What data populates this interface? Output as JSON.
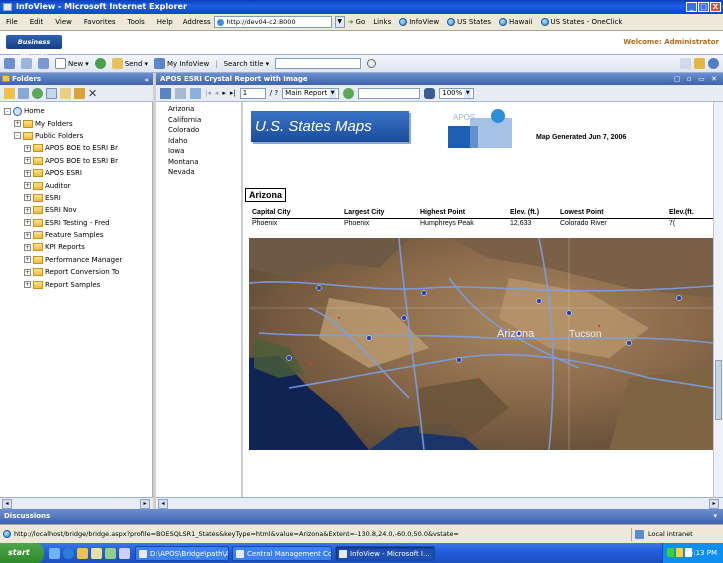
{
  "window": {
    "title": "InfoView - Microsoft Internet Explorer",
    "buttons": [
      "_",
      "□",
      "X"
    ]
  },
  "menubar": {
    "items": [
      "File",
      "Edit",
      "View",
      "Favorites",
      "Tools",
      "Help"
    ],
    "address_label": "Address",
    "address_value": "http://dev04-c2:8000",
    "go_label": "Go",
    "links_label": "Links",
    "links": [
      "InfoView",
      "US States",
      "Hawaii",
      "US States - OneClick"
    ]
  },
  "app_header": {
    "logo": "Business Objects",
    "welcome": "Welcome: Administrator"
  },
  "toolbar": {
    "new_label": "New",
    "send_label": "Send",
    "my_infoview_label": "My InfoView",
    "search_title_label": "Search title",
    "search_value": ""
  },
  "left_panel": {
    "title": "Folders",
    "tree": [
      {
        "label": "Home",
        "level": 0,
        "expander": "-",
        "icon": "home-icon"
      },
      {
        "label": "My Folders",
        "level": 1,
        "expander": "+",
        "icon": "folder-icon"
      },
      {
        "label": "Public Folders",
        "level": 1,
        "expander": "-",
        "icon": "folder-icon"
      },
      {
        "label": "APOS BOE to ESRI Br",
        "level": 2,
        "expander": "+",
        "icon": "folder-icon"
      },
      {
        "label": "APOS BOE to ESRI Br",
        "level": 2,
        "expander": "+",
        "icon": "folder-icon"
      },
      {
        "label": "APOS ESRI",
        "level": 2,
        "expander": "+",
        "icon": "folder-icon"
      },
      {
        "label": "Auditor",
        "level": 2,
        "expander": "+",
        "icon": "folder-icon"
      },
      {
        "label": "ESRI",
        "level": 2,
        "expander": "+",
        "icon": "folder-icon"
      },
      {
        "label": "ESRI Nov",
        "level": 2,
        "expander": "+",
        "icon": "folder-icon"
      },
      {
        "label": "ESRI Testing - Fred",
        "level": 2,
        "expander": "+",
        "icon": "folder-icon"
      },
      {
        "label": "Feature Samples",
        "level": 2,
        "expander": "+",
        "icon": "folder-icon"
      },
      {
        "label": "KPI Reports",
        "level": 2,
        "expander": "+",
        "icon": "folder-icon"
      },
      {
        "label": "Performance Manager",
        "level": 2,
        "expander": "+",
        "icon": "folder-icon"
      },
      {
        "label": "Report Conversion To",
        "level": 2,
        "expander": "+",
        "icon": "folder-icon"
      },
      {
        "label": "Report Samples",
        "level": 2,
        "expander": "+",
        "icon": "folder-icon"
      }
    ]
  },
  "content": {
    "title": "APOS ESRI Crystal Report with Image",
    "page_input": "1",
    "page_total": "/ ?",
    "report_select": "Main Report",
    "zoom": "100%",
    "find_value": "",
    "state_list": [
      "Arizona",
      "California",
      "Colorado",
      "Idaho",
      "Iowa",
      "Montana",
      "Nevada"
    ]
  },
  "report": {
    "title": "U.S. States Maps",
    "logo_text": "APOS",
    "map_generated": "Map Generated Jun 7, 2006",
    "state": "Arizona",
    "columns": [
      "Capital City",
      "Largest City",
      "Highest Point",
      "Elev. (ft.)",
      "Lowest Point",
      "Elev.(ft."
    ],
    "rows": [
      [
        "Phoenix",
        "Phoenix",
        "Humphreys Peak",
        "12,633",
        "Colorado River",
        "7("
      ]
    ],
    "map_label": "Arizona",
    "map_label2": "Tucson"
  },
  "discussions": {
    "label": "Discussions"
  },
  "status": {
    "url": "http://localhost/bridge/bridge.aspx?profile=BOESQLSR1_States&keyType=html&value=Arizona&Extent=-130.8,24.0,-60.0,50.0&vstate=",
    "zone": "Local intranet"
  },
  "taskbar": {
    "start": "start",
    "tasks": [
      {
        "label": "D:\\APOS\\Bridge\\path\\APOS V...",
        "active": false
      },
      {
        "label": "Central Management Con...",
        "active": false
      },
      {
        "label": "InfoView - Microsoft I...",
        "active": true
      }
    ],
    "clock": "5:13 PM"
  },
  "colors": {
    "xp_blue": "#245edb",
    "panel_title": "#3e63ad",
    "report_title_bg": "#1a4c98",
    "welcome": "#b06a1a"
  }
}
